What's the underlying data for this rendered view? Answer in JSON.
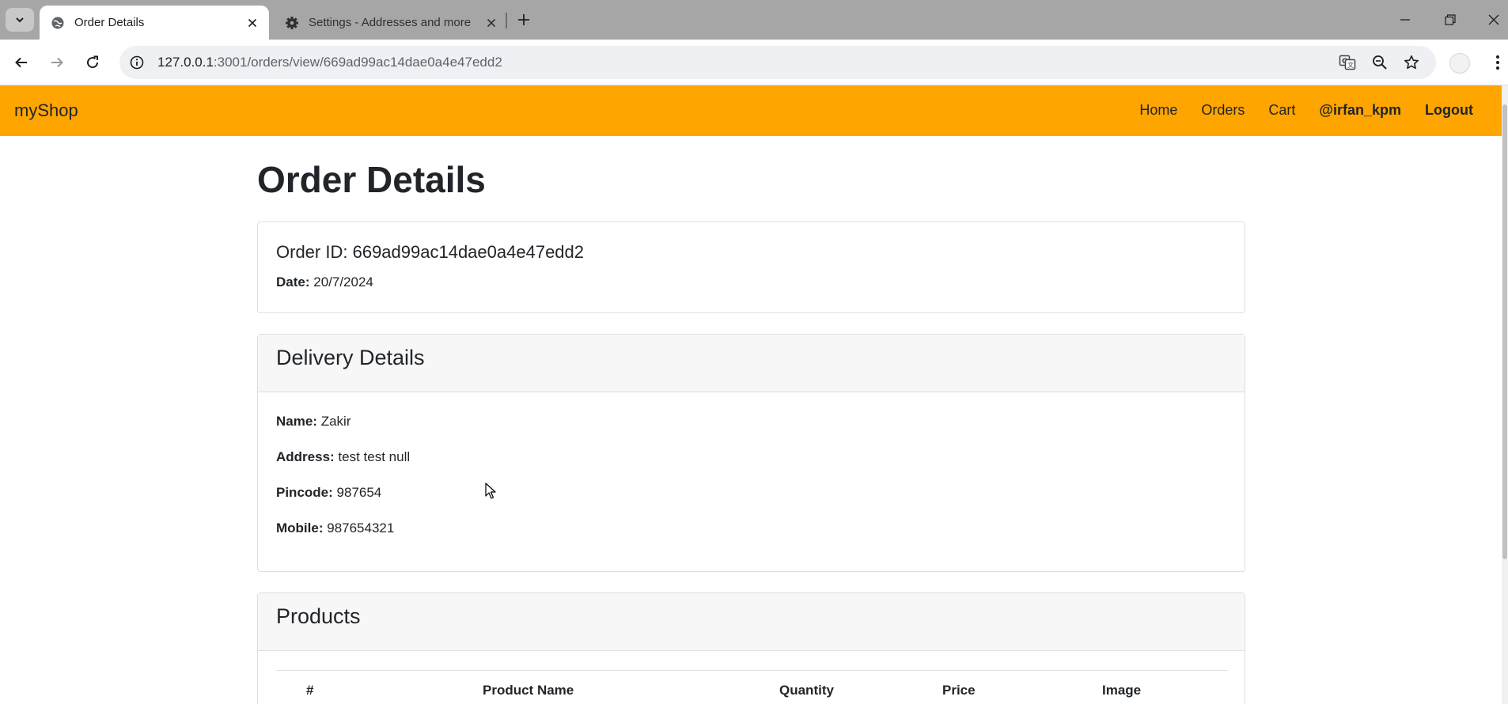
{
  "browser": {
    "tabs": [
      {
        "title": "Order Details",
        "active": true,
        "icon": "globe-icon"
      },
      {
        "title": "Settings - Addresses and more",
        "active": false,
        "icon": "gear-icon"
      }
    ],
    "url_host": "127.0.0.1",
    "url_rest": ":3001/orders/view/669ad99ac14dae0a4e47edd2"
  },
  "site": {
    "brand": "myShop",
    "nav": {
      "home": "Home",
      "orders": "Orders",
      "cart": "Cart",
      "user": "@irfan_kpm",
      "logout": "Logout"
    },
    "accent_color": "#ffa500"
  },
  "page": {
    "title": "Order Details",
    "order_id_label": "Order ID:",
    "order_id": "669ad99ac14dae0a4e47edd2",
    "date_label": "Date:",
    "date": "20/7/2024"
  },
  "delivery": {
    "heading": "Delivery Details",
    "fields": [
      {
        "label": "Name:",
        "value": "Zakir"
      },
      {
        "label": "Address:",
        "value": "test test null"
      },
      {
        "label": "Pincode:",
        "value": "987654"
      },
      {
        "label": "Mobile:",
        "value": "987654321"
      }
    ]
  },
  "products": {
    "heading": "Products",
    "columns": [
      "#",
      "Product Name",
      "Quantity",
      "Price",
      "Image"
    ]
  }
}
